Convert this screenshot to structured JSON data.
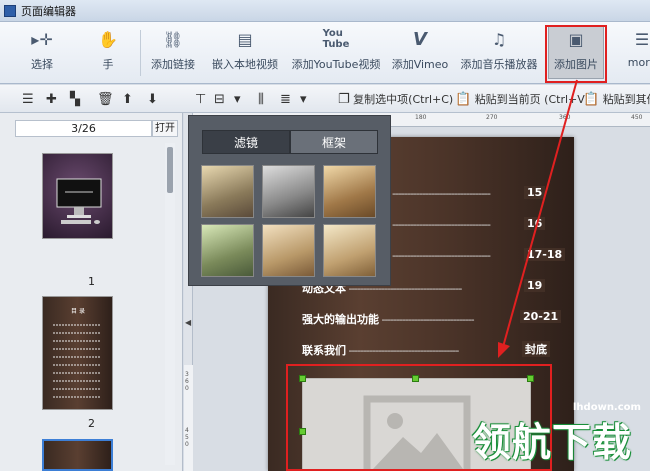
{
  "window": {
    "title": "页面编辑器"
  },
  "ribbon": {
    "items": [
      {
        "label": "选择",
        "icon": "pointer-move-icon"
      },
      {
        "label": "手",
        "icon": "hand-icon"
      },
      {
        "label": "添加链接",
        "icon": "link-icon"
      },
      {
        "label": "嵌入本地视频",
        "icon": "film-icon"
      },
      {
        "label": "添加YouTube视频",
        "icon": "youtube-icon"
      },
      {
        "label": "添加Vimeo",
        "icon": "vimeo-icon"
      },
      {
        "label": "添加音乐播放器",
        "icon": "music-note-icon"
      },
      {
        "label": "添加图片",
        "icon": "image-icon",
        "active": true
      },
      {
        "label": "more",
        "icon": "more-icon"
      }
    ]
  },
  "subtoolbar": {
    "copy_label": "复制选中项(Ctrl+C)",
    "paste_label": "粘贴到当前页 (Ctrl+V)",
    "paste_other_label": "粘贴到其他"
  },
  "leftpanel": {
    "page_indicator": "3/26",
    "open_button": "打开",
    "thumbnails": [
      {
        "number": "1"
      },
      {
        "number": "2"
      }
    ]
  },
  "ruler": {
    "h_ticks": [
      "180",
      "270",
      "360",
      "450"
    ],
    "v_ticks": [
      "360",
      "450"
    ]
  },
  "popup": {
    "tabs": [
      {
        "label": "滤镜",
        "active": true
      },
      {
        "label": "框架",
        "active": false
      }
    ],
    "filters": [
      "original",
      "grayscale",
      "warm",
      "cool",
      "vintage",
      "vivid"
    ]
  },
  "page": {
    "toc": [
      {
        "text": "",
        "page": "15"
      },
      {
        "text": "",
        "page": "16"
      },
      {
        "text": "",
        "page": "17-18"
      },
      {
        "text": "动态文本",
        "page": "19"
      },
      {
        "text": "强大的输出功能",
        "page": "20-21"
      },
      {
        "text": "联系我们",
        "page": "封底"
      }
    ]
  },
  "watermark": {
    "url": "lhdown.com",
    "text": "领航下载"
  },
  "colors": {
    "highlight": "#e02020",
    "handle": "#66cc33",
    "page_bg": "#4a3328"
  }
}
